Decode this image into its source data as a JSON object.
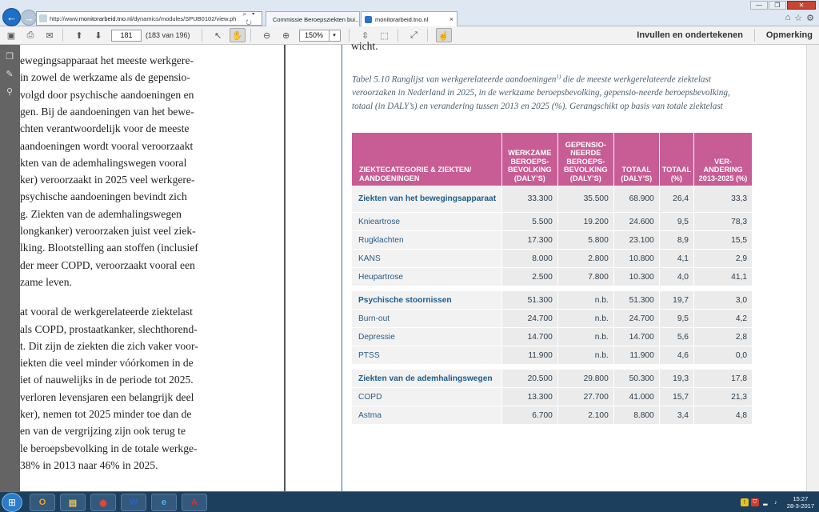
{
  "browser": {
    "url_prefix": "http://www.",
    "url_host": "monitorarbeid.tno.nl",
    "url_path": "/dynamics/modules/SPUB0102/view.ph",
    "address_controls": "⌕ ▾ ↻",
    "tabs": [
      {
        "label": "Commissie Beroepsziekten bui...",
        "close": "×",
        "color": "#333333"
      },
      {
        "label": "monitorarbeid.tno.nl",
        "close": "×",
        "color": "#2a73c4"
      }
    ],
    "window_controls": {
      "minimize": "—",
      "restore": "❐",
      "close": "✕"
    },
    "tool_icons": [
      "⌂",
      "☆",
      "⚙"
    ]
  },
  "pdf_toolbar": {
    "page_number": "181",
    "page_count": "(183 van 196)",
    "zoom": "150%",
    "zoom_caret": "▾",
    "sign_label": "Invullen en ondertekenen",
    "comment_label": "Opmerking"
  },
  "left_page": {
    "lines": [
      "ewegingsapparaat het meeste werkgere-",
      "in zowel de werkzame als de gepensio-",
      "volgd door psychische aandoeningen en",
      "gen. Bij de aandoeningen van het bewe-",
      "chten verantwoordelijk voor de meeste",
      "aandoeningen wordt vooral veroorzaakt",
      "kten van de ademhalingswegen vooral",
      "ker) veroorzaakt in 2025 veel werkgere-",
      "psychische aandoeningen bevindt zich",
      "g. Ziekten van de ademhalingswegen",
      "longkanker) veroorzaken juist veel ziek-",
      "lking. Blootstelling aan stoffen (inclusief",
      "der meer COPD, veroorzaakt vooral een",
      "zame leven.",
      "",
      "at vooral de werkgerelateerde ziektelast",
      "als COPD, prostaatkanker, slechthorend-",
      "t. Dit zijn de ziekten die zich vaker voor-",
      "iekten die veel minder vóórkomen in de",
      "iet of nauwelijks in de periode tot 2025.",
      "verloren levensjaren een belangrijk deel",
      "ker), nemen tot 2025 minder toe dan de",
      "en van de vergrijzing zijn ook terug te",
      "le beroepsbevolking in de totale werkge-",
      "38% in 2013 naar 46% in 2025."
    ]
  },
  "right_page": {
    "top_word": "wicht.",
    "caption_part1": "Tabel 5.10  Ranglijst van werkgerelateerde aandoeningen",
    "caption_sup": "1)",
    "caption_part2": " die de meeste werkgerelateerde ziektelast veroorzaken in Nederland in 2025, in de werkzame beroepsbevolking, gepensio-neerde beroepsbevolking, totaal (in DALY’s) en verandering tussen 2013 en 2025 (%). Gerangschikt op basis van totale ziektelast",
    "table": {
      "headers": [
        "ZIEKTECATEGORIE & ZIEKTEN/ AANDOENINGEN",
        "WERKZAME BEROEPS-BEVOLKING (DALY’S)",
        "GEPENSIO-NEERDE BEROEPS-BEVOLKING (DALY’S)",
        "TOTAAL (DALY’S)",
        "TOTAAL (%)",
        "VER-ANDERING 2013-2025 (%)"
      ],
      "groups": [
        {
          "row": [
            "Ziekten van het bewegingsapparaat",
            "33.300",
            "35.500",
            "68.900",
            "26,4",
            "33,3"
          ],
          "items": [
            [
              "Knieartrose",
              "5.500",
              "19.200",
              "24.600",
              "9,5",
              "78,3"
            ],
            [
              "Rugklachten",
              "17.300",
              "5.800",
              "23.100",
              "8,9",
              "15,5"
            ],
            [
              "KANS",
              "8.000",
              "2.800",
              "10.800",
              "4,1",
              "2,9"
            ],
            [
              "Heupartrose",
              "2.500",
              "7.800",
              "10.300",
              "4,0",
              "41,1"
            ]
          ]
        },
        {
          "row": [
            "Psychische stoornissen",
            "51.300",
            "n.b.",
            "51.300",
            "19,7",
            "3,0"
          ],
          "items": [
            [
              "Burn-out",
              "24.700",
              "n.b.",
              "24.700",
              "9,5",
              "4,2"
            ],
            [
              "Depressie",
              "14.700",
              "n.b.",
              "14.700",
              "5,6",
              "2,8"
            ],
            [
              "PTSS",
              "11.900",
              "n.b.",
              "11.900",
              "4,6",
              "0,0"
            ]
          ]
        },
        {
          "row": [
            "Ziekten van de ademhalingswegen",
            "20.500",
            "29.800",
            "50.300",
            "19,3",
            "17,8"
          ],
          "items": [
            [
              "COPD",
              "13.300",
              "27.700",
              "41.000",
              "15,7",
              "21,3"
            ],
            [
              "Astma",
              "6.700",
              "2.100",
              "8.800",
              "3,4",
              "4,8"
            ]
          ]
        }
      ]
    }
  },
  "taskbar": {
    "start_icon": "⊞",
    "apps": [
      {
        "name": "outlook-taskbar-icon",
        "glyph": "O",
        "color": "#f0a030"
      },
      {
        "name": "file-explorer-taskbar-icon",
        "glyph": "▤",
        "color": "#e8c25a"
      },
      {
        "name": "chrome-taskbar-icon",
        "glyph": "◉",
        "color": "#e04b3b"
      },
      {
        "name": "word-taskbar-icon",
        "glyph": "W",
        "color": "#2b62b8"
      },
      {
        "name": "internet-explorer-taskbar-icon",
        "glyph": "e",
        "color": "#4fb3f0"
      },
      {
        "name": "acrobat-taskbar-icon",
        "glyph": "A",
        "color": "#d8312a"
      }
    ],
    "time": "15:27",
    "date": "28-3-2017"
  }
}
